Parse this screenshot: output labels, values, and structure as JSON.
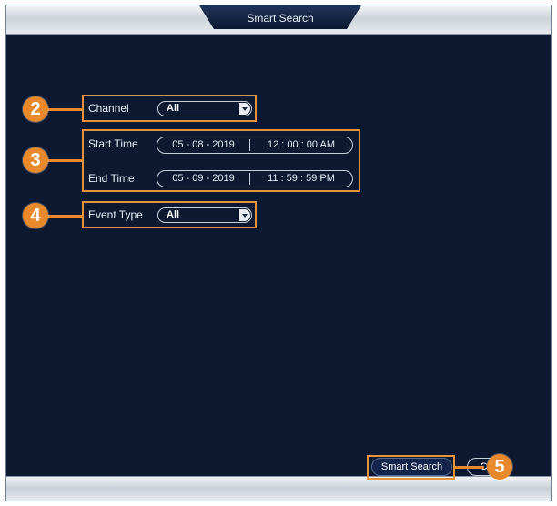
{
  "window": {
    "title": "Smart Search"
  },
  "form": {
    "channel": {
      "label": "Channel",
      "value": "All"
    },
    "start_time": {
      "label": "Start Time",
      "date": "05 - 08 - 2019",
      "time": "12 : 00 : 00  AM"
    },
    "end_time": {
      "label": "End Time",
      "date": "05 - 09 - 2019",
      "time": "11 : 59 : 59  PM"
    },
    "event_type": {
      "label": "Event Type",
      "value": "All"
    }
  },
  "buttons": {
    "smart_search": "Smart Search",
    "other": "C"
  },
  "callouts": {
    "channel": "2",
    "time_range": "3",
    "event_type": "4",
    "smart_search": "5"
  },
  "colors": {
    "accent": "#e8892c",
    "background": "#0c1930"
  }
}
